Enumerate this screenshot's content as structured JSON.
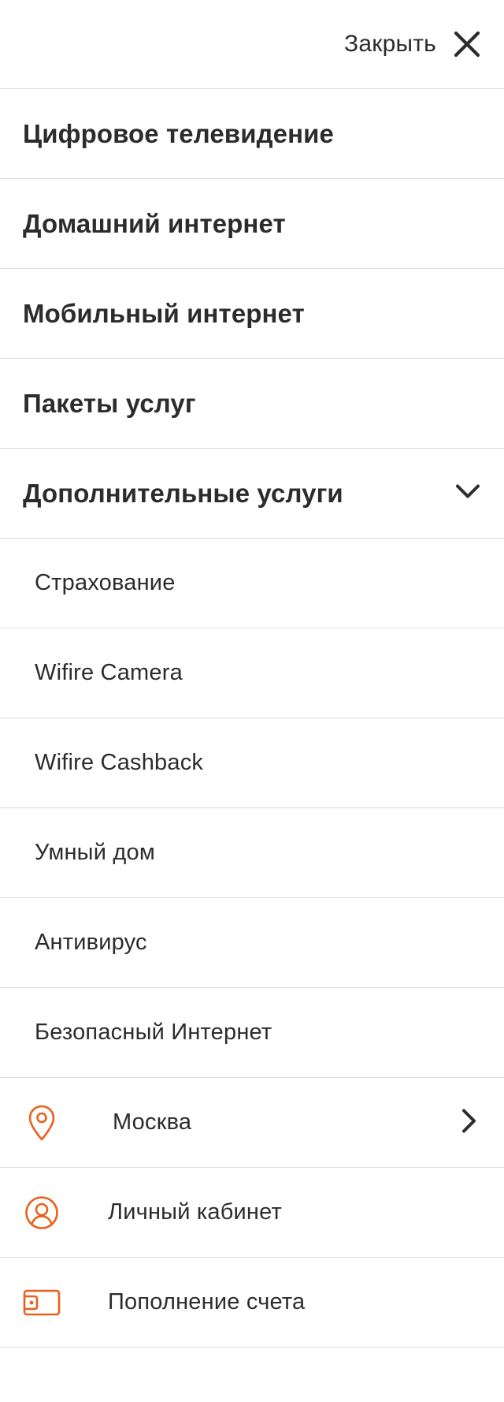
{
  "header": {
    "close_label": "Закрыть"
  },
  "main_items": [
    {
      "label": "Цифровое телевидение"
    },
    {
      "label": "Домашний интернет"
    },
    {
      "label": "Мобильный интернет"
    },
    {
      "label": "Пакеты услуг"
    },
    {
      "label": "Дополнительные услуги",
      "expanded": true
    }
  ],
  "sub_items": [
    {
      "label": "Страхование"
    },
    {
      "label": "Wifire Camera"
    },
    {
      "label": "Wifire Cashback"
    },
    {
      "label": "Умный дом"
    },
    {
      "label": "Антивирус"
    },
    {
      "label": "Безопасный Интернет"
    }
  ],
  "utility": {
    "city": {
      "label": "Москва",
      "icon": "location-pin-icon"
    },
    "account": {
      "label": "Личный кабинет",
      "icon": "user-circle-icon"
    },
    "topup": {
      "label": "Пополнение счета",
      "icon": "wallet-icon"
    }
  },
  "colors": {
    "accent": "#e8601c",
    "text": "#2c2c2c",
    "divider": "#dcdde3"
  }
}
